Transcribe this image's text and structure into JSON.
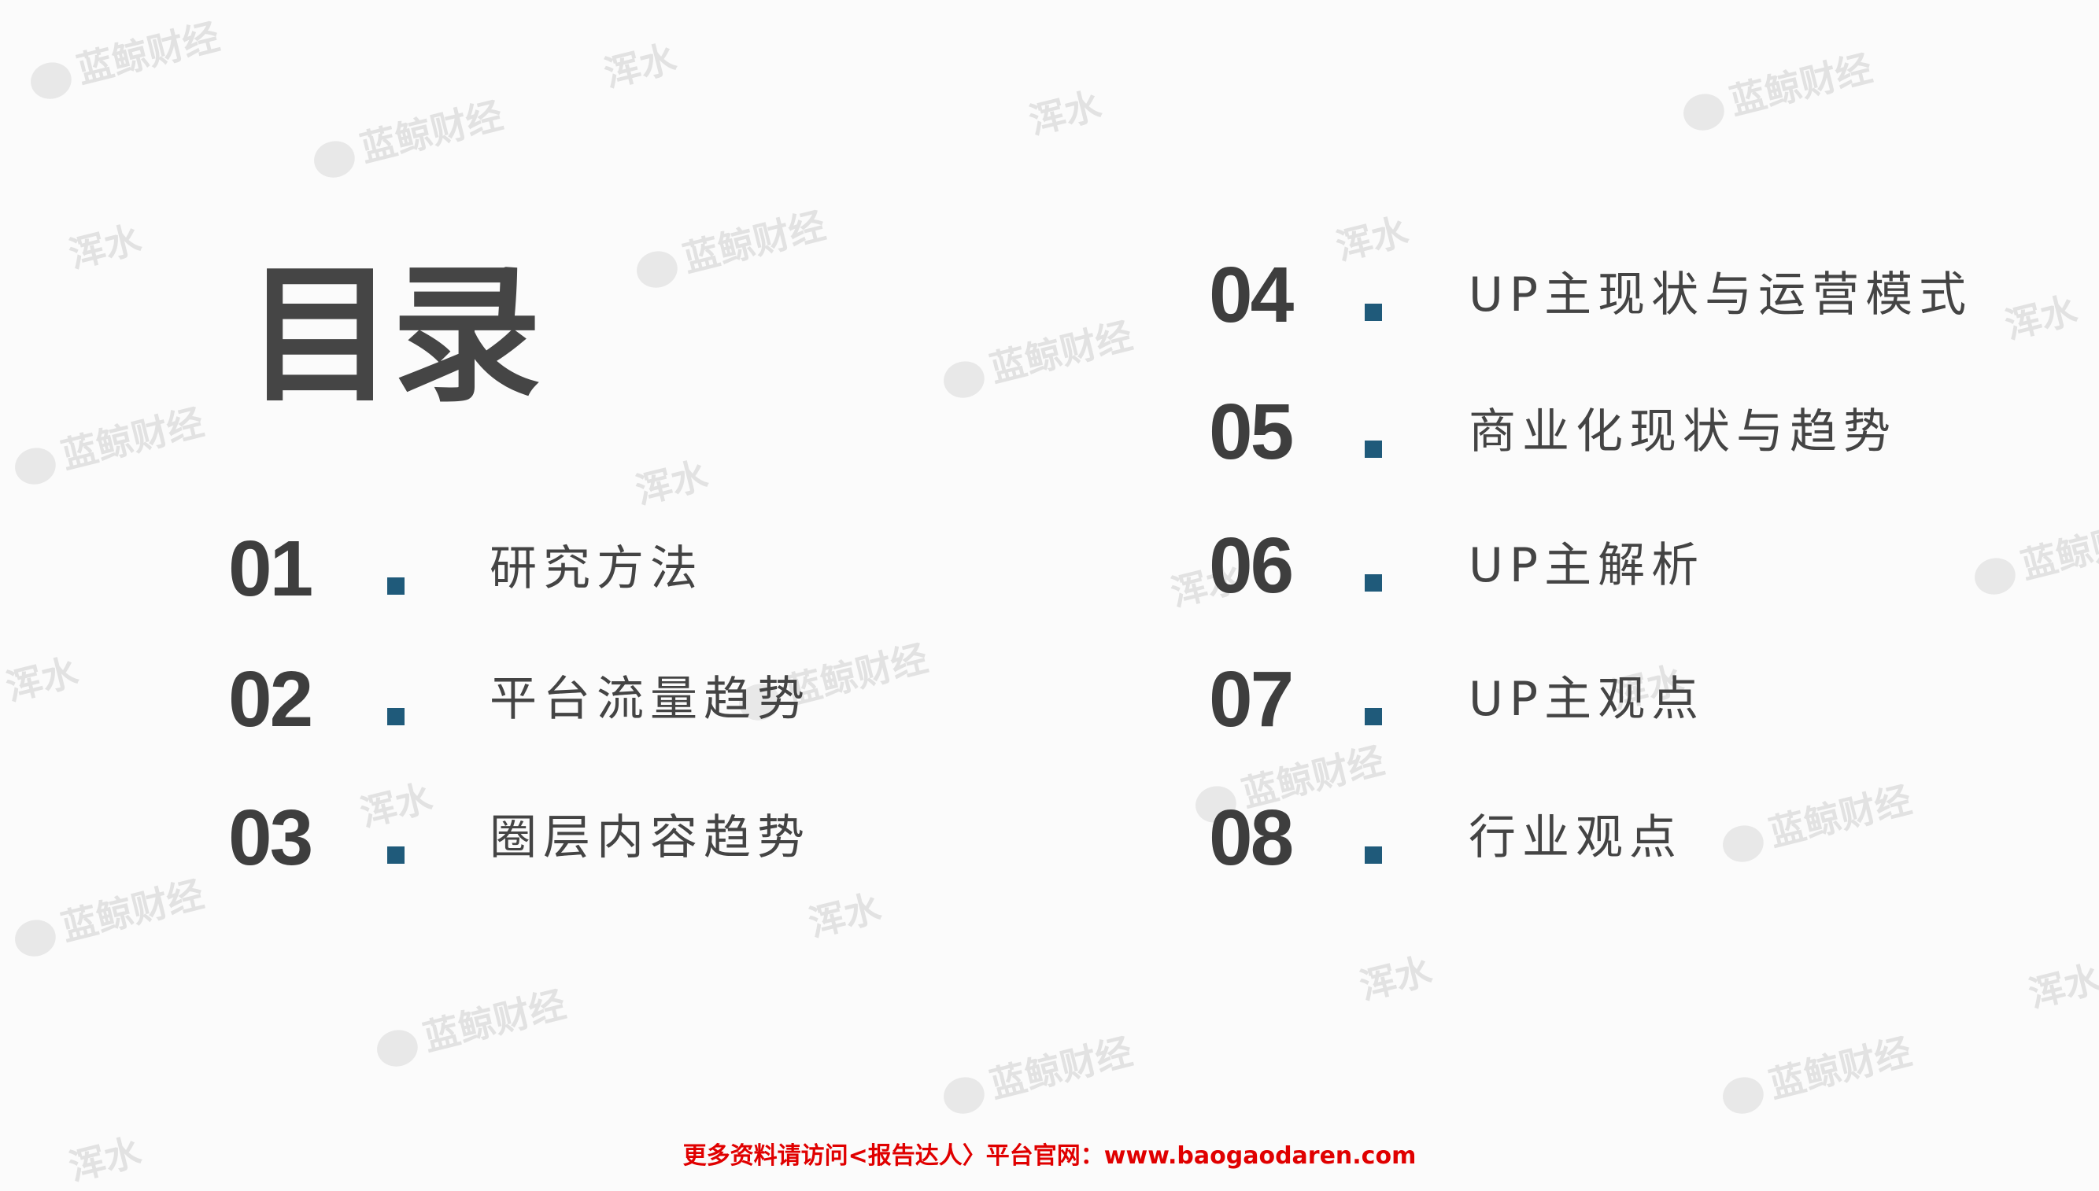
{
  "title": "目录",
  "left_items": [
    {
      "number": "01",
      "label": "研究方法"
    },
    {
      "number": "02",
      "label": "平台流量趋势"
    },
    {
      "number": "03",
      "label": "圈层内容趋势"
    }
  ],
  "right_items": [
    {
      "number": "04",
      "label": "UP主现状与运营模式"
    },
    {
      "number": "05",
      "label": "商业化现状与趋势"
    },
    {
      "number": "06",
      "label": "UP主解析"
    },
    {
      "number": "07",
      "label": "UP主观点"
    },
    {
      "number": "08",
      "label": "行业观点"
    }
  ],
  "footer": "更多资料请访问<报告达人〉平台官网：www.baogaodaren.com",
  "watermarks": {
    "brand_a": "蓝鲸财经",
    "brand_b": "浑水"
  },
  "colors": {
    "text": "#444444",
    "number": "#3e3e3e",
    "accent_square": "#1f5a7a",
    "footer": "#e00000"
  }
}
